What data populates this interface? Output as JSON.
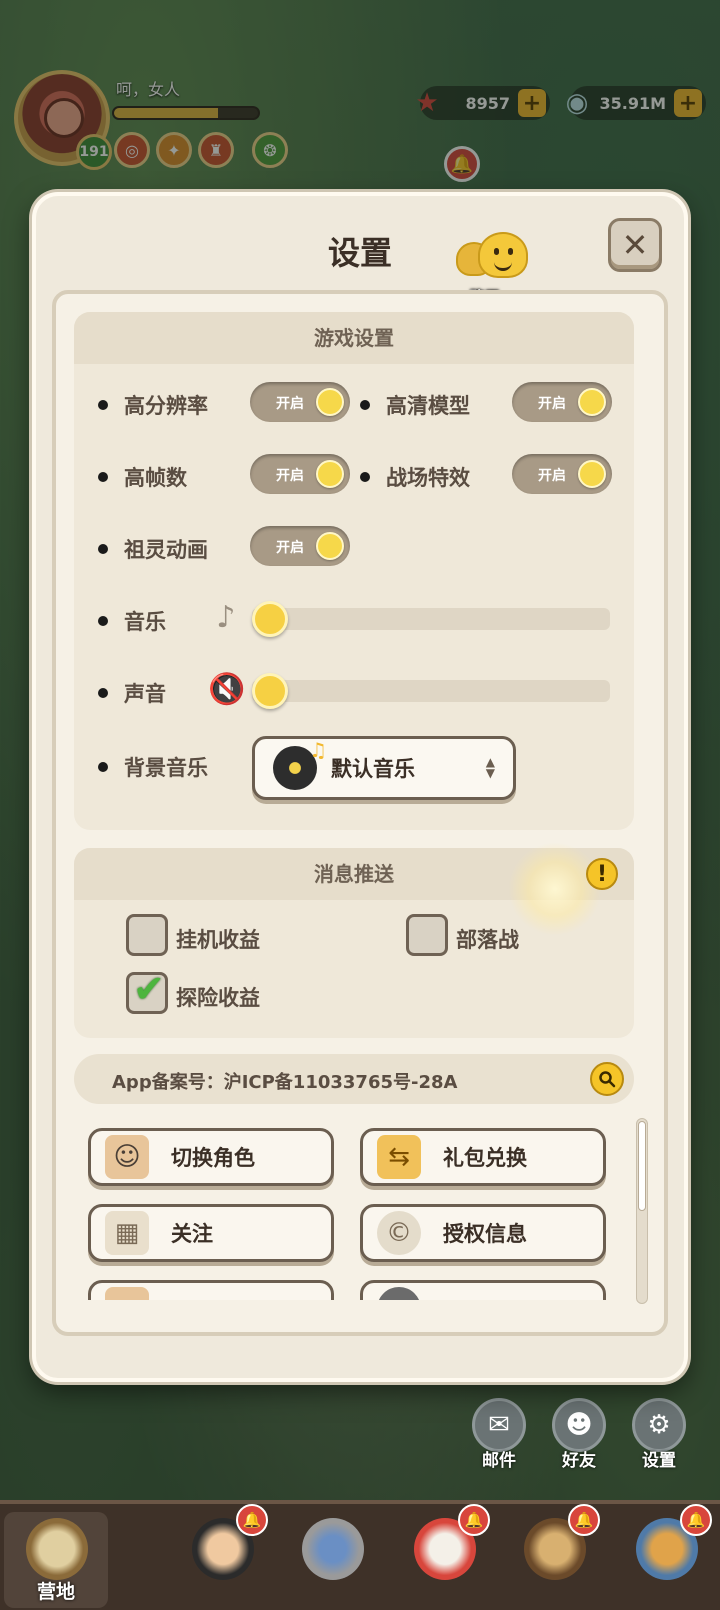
{
  "hud": {
    "player_name": "呵，女人",
    "level": "191",
    "xp_progress": 0.72,
    "stars": "8957",
    "shells": "35.91M",
    "buff_icons": [
      "buff-icon-1",
      "buff-icon-2",
      "buff-icon-3",
      "buff-icon-4"
    ]
  },
  "dialog": {
    "title": "设置",
    "close_label": "✕",
    "chat_label": "聊天"
  },
  "game_settings": {
    "title": "游戏设置",
    "toggle_on_label": "开启",
    "options": {
      "high_resolution": "高分辨率",
      "hd_model": "高清模型",
      "high_fps": "高帧数",
      "battle_effects": "战场特效",
      "spirit_animation": "祖灵动画"
    },
    "music_label": "音乐",
    "music_level": 0,
    "sound_label": "声音",
    "sound_level": 0,
    "bgm_label": "背景音乐",
    "bgm_value": "默认音乐"
  },
  "push_settings": {
    "title": "消息推送",
    "idle_income": "挂机收益",
    "idle_income_checked": false,
    "tribe_war": "部落战",
    "tribe_war_checked": false,
    "explore_income": "探险收益",
    "explore_income_checked": true
  },
  "app_record": "App备案号：沪ICP备11033765号-28A",
  "menu_buttons": {
    "switch_role": "切换角色",
    "gift_redeem": "礼包兑换",
    "follow": "关注",
    "license_info": "授权信息"
  },
  "side_buttons": {
    "mail": "邮件",
    "friends": "好友",
    "settings": "设置"
  },
  "bottom_nav": {
    "camp": "营地"
  },
  "colors": {
    "dialog_bg": "#efe9dc",
    "toggle_knob": "#f6d84a",
    "check_green": "#4db53e"
  }
}
